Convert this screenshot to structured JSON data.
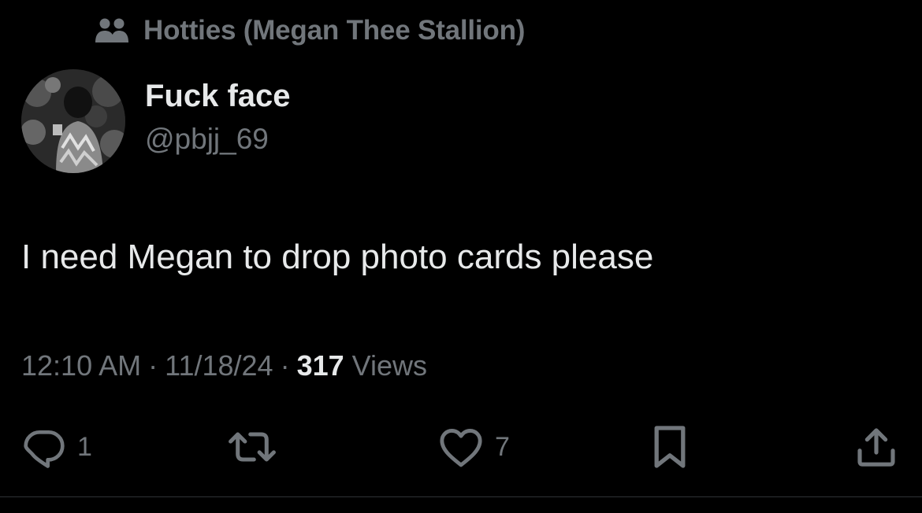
{
  "community": {
    "icon": "community-icon",
    "name": "Hotties (Megan Thee Stallion)"
  },
  "author": {
    "avatar_icon": "avatar-photo",
    "display_name": "Fuck face",
    "handle": "@pbjj_69"
  },
  "tweet": {
    "text": "I need Megan to drop photo cards please"
  },
  "meta": {
    "time": "12:10 AM",
    "separator": "·",
    "date": "11/18/24",
    "views_count": "317",
    "views_label": "Views"
  },
  "actions": {
    "reply": {
      "icon": "reply-icon",
      "count": "1"
    },
    "retweet": {
      "icon": "retweet-icon",
      "count": ""
    },
    "like": {
      "icon": "heart-icon",
      "count": "7"
    },
    "bookmark": {
      "icon": "bookmark-icon"
    },
    "share": {
      "icon": "share-icon"
    }
  },
  "colors": {
    "background": "#000000",
    "primary_text": "#e7e9ea",
    "secondary_text": "#71767b",
    "divider": "#2f3336"
  }
}
